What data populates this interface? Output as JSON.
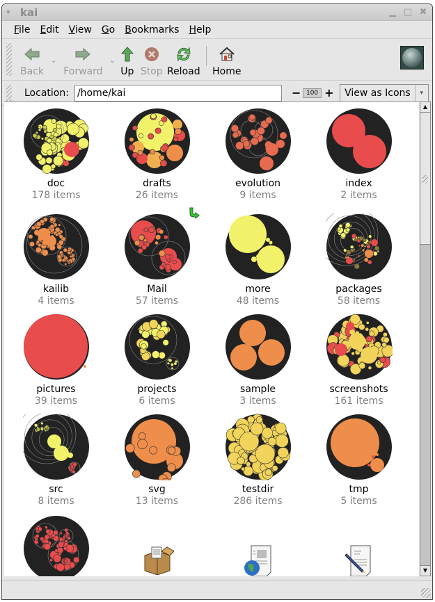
{
  "window": {
    "title": "kai"
  },
  "menubar": [
    "File",
    "Edit",
    "View",
    "Go",
    "Bookmarks",
    "Help"
  ],
  "toolbar": {
    "back": {
      "label": "Back",
      "enabled": false
    },
    "forward": {
      "label": "Forward",
      "enabled": false
    },
    "up": {
      "label": "Up",
      "enabled": true
    },
    "stop": {
      "label": "Stop",
      "enabled": false
    },
    "reload": {
      "label": "Reload",
      "enabled": true
    },
    "home": {
      "label": "Home",
      "enabled": true
    }
  },
  "location": {
    "label": "Location:",
    "value": "/home/kai",
    "zoom_minus": "−",
    "zoom_value": "100",
    "zoom_plus": "+",
    "view_mode": "View as Icons"
  },
  "colors": {
    "red": "#e84c4c",
    "orange": "#ee8e4a",
    "yellow": "#f2f26a",
    "gold": "#f2d45a",
    "dark": "#222222"
  },
  "items": [
    {
      "name": "doc",
      "count": "178 items",
      "style": "mixed-yellow"
    },
    {
      "name": "drafts",
      "count": "26 items",
      "style": "big-yellow"
    },
    {
      "name": "evolution",
      "count": "9 items",
      "style": "orange-red-nested"
    },
    {
      "name": "index",
      "count": "2 items",
      "style": "two-red"
    },
    {
      "name": "kailib",
      "count": "4 items",
      "style": "orange-nested"
    },
    {
      "name": "Mail",
      "count": "57 items",
      "style": "red-nested",
      "emblem": "symlink-arrow-icon"
    },
    {
      "name": "more",
      "count": "48 items",
      "style": "two-yellow"
    },
    {
      "name": "packages",
      "count": "58 items",
      "style": "mixed-nested"
    },
    {
      "name": "pictures",
      "count": "39 items",
      "style": "single-red"
    },
    {
      "name": "projects",
      "count": "6 items",
      "style": "gold-cluster"
    },
    {
      "name": "sample",
      "count": "3 items",
      "style": "three-orange"
    },
    {
      "name": "screenshots",
      "count": "161 items",
      "style": "gold-packed"
    },
    {
      "name": "src",
      "count": "8 items",
      "style": "yellow-nested"
    },
    {
      "name": "svg",
      "count": "13 items",
      "style": "big-orange"
    },
    {
      "name": "testdir",
      "count": "286 items",
      "style": "gold-dense"
    },
    {
      "name": "tmp",
      "count": "5 items",
      "style": "orange-tmp"
    },
    {
      "name": "",
      "count": "",
      "style": "red-clusters"
    },
    {
      "name": "",
      "count": "",
      "style": "file-package",
      "icon": "package-icon"
    },
    {
      "name": "",
      "count": "",
      "style": "file-html",
      "icon": "web-document-icon"
    },
    {
      "name": "",
      "count": "",
      "style": "file-text",
      "icon": "text-document-icon"
    }
  ]
}
